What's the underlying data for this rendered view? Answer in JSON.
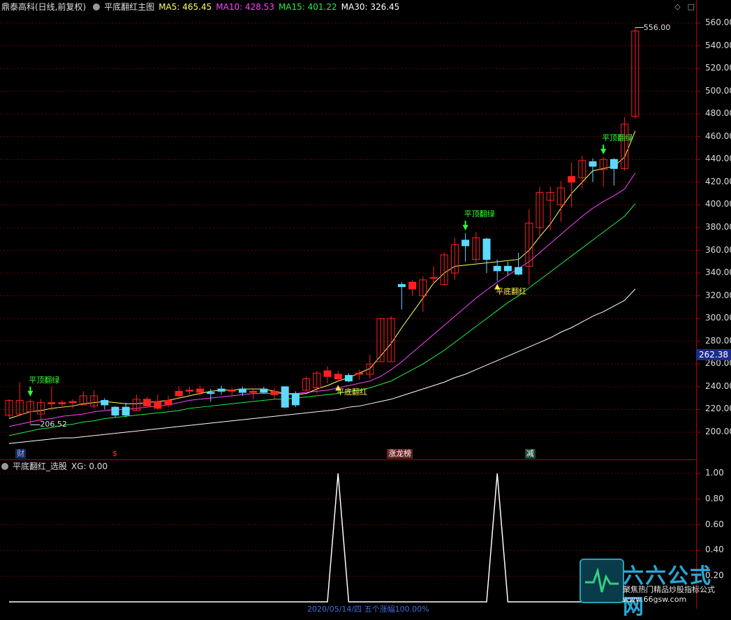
{
  "colors": {
    "background": "#000000",
    "grid": "#6a0000",
    "axis": "#b00000",
    "up": "#ff2020",
    "down": "#5fd8ff",
    "ma5": "#ffff66",
    "ma10": "#ff44ff",
    "ma15": "#22ee44",
    "ma30": "#ffffff",
    "signal_green": "#33ff33",
    "signal_red": "#ffee44"
  },
  "header": {
    "stock_name": "鼎泰高科(日线,前复权)",
    "indicator_name": "平底翻红主图",
    "ma5": "MA5: 465.45",
    "ma10": "MA10: 428.53",
    "ma15": "MA15: 401.22",
    "ma30": "MA30: 326.45"
  },
  "main_chart": {
    "y_ticks": [
      "560.00",
      "540.00",
      "520.00",
      "500.00",
      "480.00",
      "460.00",
      "440.00",
      "420.00",
      "400.00",
      "380.00",
      "360.00",
      "340.00",
      "320.00",
      "300.00",
      "280.00",
      "260.00",
      "240.00",
      "220.00",
      "200.00"
    ],
    "current_price_tag": "262.38",
    "high_label": "556.00",
    "low_label": "206.52",
    "signals": [
      {
        "text": "平顶翻绿",
        "kind": "green"
      },
      {
        "text": "平顶翻绿",
        "kind": "green"
      },
      {
        "text": "平顶翻绿",
        "kind": "green"
      },
      {
        "text": "平底翻红",
        "kind": "red"
      },
      {
        "text": "平底翻红",
        "kind": "red"
      }
    ],
    "events": [
      {
        "text": "财",
        "color": "#6aa0ff"
      },
      {
        "text": "$",
        "color": "#ff3030"
      },
      {
        "text": "涨龙榜",
        "color": "#ffffff"
      },
      {
        "text": "减",
        "color": "#ffffff"
      }
    ]
  },
  "sub_chart": {
    "title": "平底翻红_选股",
    "xg_label": "XG: 0.00",
    "y_ticks": [
      "1.00",
      "0.80",
      "0.60",
      "0.40",
      "0.20"
    ]
  },
  "footer": {
    "date_text": "2020/05/14/四  五个涨幅100.00%"
  },
  "watermark": {
    "brand": "六六公式网",
    "slogan": "聚焦热门精品炒股指标公式",
    "url": "www.66gsw.com"
  },
  "chart_data": {
    "type": "candlestick",
    "ylim": [
      190,
      570
    ],
    "candles": [
      {
        "o": 215,
        "c": 228,
        "h": 229,
        "l": 213
      },
      {
        "o": 216,
        "c": 228,
        "h": 244,
        "l": 214
      },
      {
        "o": 218,
        "c": 227,
        "h": 229,
        "l": 207
      },
      {
        "o": 216,
        "c": 226,
        "h": 229,
        "l": 210
      },
      {
        "o": 225,
        "c": 226,
        "h": 240,
        "l": 219
      },
      {
        "o": 225,
        "c": 226,
        "h": 228,
        "l": 222
      },
      {
        "o": 226,
        "c": 227,
        "h": 229,
        "l": 221
      },
      {
        "o": 224,
        "c": 232,
        "h": 236,
        "l": 224
      },
      {
        "o": 223,
        "c": 232,
        "h": 237,
        "l": 221
      },
      {
        "o": 228,
        "c": 224,
        "h": 230,
        "l": 220
      },
      {
        "o": 222,
        "c": 215,
        "h": 223,
        "l": 213
      },
      {
        "o": 222,
        "c": 215,
        "h": 226,
        "l": 213
      },
      {
        "o": 219,
        "c": 229,
        "h": 233,
        "l": 219
      },
      {
        "o": 223,
        "c": 229,
        "h": 231,
        "l": 223
      },
      {
        "o": 221,
        "c": 227,
        "h": 233,
        "l": 220
      },
      {
        "o": 224,
        "c": 228,
        "h": 232,
        "l": 222
      },
      {
        "o": 232,
        "c": 236,
        "h": 240,
        "l": 230
      },
      {
        "o": 236,
        "c": 237,
        "h": 240,
        "l": 233
      },
      {
        "o": 235,
        "c": 238,
        "h": 241,
        "l": 232
      },
      {
        "o": 235,
        "c": 234,
        "h": 238,
        "l": 227
      },
      {
        "o": 238,
        "c": 236,
        "h": 241,
        "l": 233
      },
      {
        "o": 236,
        "c": 237,
        "h": 239,
        "l": 231
      },
      {
        "o": 238,
        "c": 235,
        "h": 240,
        "l": 232
      },
      {
        "o": 235,
        "c": 236,
        "h": 238,
        "l": 229
      },
      {
        "o": 238,
        "c": 235,
        "h": 240,
        "l": 234
      },
      {
        "o": 233,
        "c": 236,
        "h": 239,
        "l": 229
      },
      {
        "o": 240,
        "c": 222,
        "h": 240,
        "l": 221
      },
      {
        "o": 234,
        "c": 224,
        "h": 236,
        "l": 222
      },
      {
        "o": 237,
        "c": 247,
        "h": 249,
        "l": 236
      },
      {
        "o": 239,
        "c": 252,
        "h": 254,
        "l": 234
      },
      {
        "o": 249,
        "c": 254,
        "h": 258,
        "l": 243
      },
      {
        "o": 247,
        "c": 251,
        "h": 254,
        "l": 244
      },
      {
        "o": 250,
        "c": 245,
        "h": 252,
        "l": 244
      },
      {
        "o": 251,
        "c": 252,
        "h": 255,
        "l": 246
      },
      {
        "o": 251,
        "c": 260,
        "h": 268,
        "l": 247
      },
      {
        "o": 262,
        "c": 300,
        "h": 300,
        "l": 262
      },
      {
        "o": 262,
        "c": 300,
        "h": 302,
        "l": 262
      },
      {
        "o": 330,
        "c": 328,
        "h": 332,
        "l": 308
      },
      {
        "o": 326,
        "c": 332,
        "h": 334,
        "l": 320
      },
      {
        "o": 320,
        "c": 334,
        "h": 337,
        "l": 306
      },
      {
        "o": 336,
        "c": 336,
        "h": 346,
        "l": 330
      },
      {
        "o": 330,
        "c": 356,
        "h": 358,
        "l": 329
      },
      {
        "o": 340,
        "c": 365,
        "h": 371,
        "l": 334
      },
      {
        "o": 369,
        "c": 364,
        "h": 375,
        "l": 350
      },
      {
        "o": 352,
        "c": 371,
        "h": 376,
        "l": 349
      },
      {
        "o": 370,
        "c": 352,
        "h": 371,
        "l": 340
      },
      {
        "o": 346,
        "c": 342,
        "h": 352,
        "l": 333
      },
      {
        "o": 346,
        "c": 342,
        "h": 350,
        "l": 338
      },
      {
        "o": 345,
        "c": 339,
        "h": 358,
        "l": 338
      },
      {
        "o": 346,
        "c": 384,
        "h": 396,
        "l": 330
      },
      {
        "o": 380,
        "c": 411,
        "h": 416,
        "l": 372
      },
      {
        "o": 404,
        "c": 411,
        "h": 416,
        "l": 378
      },
      {
        "o": 400,
        "c": 415,
        "h": 421,
        "l": 385
      },
      {
        "o": 420,
        "c": 425,
        "h": 437,
        "l": 398
      },
      {
        "o": 424,
        "c": 439,
        "h": 443,
        "l": 415
      },
      {
        "o": 438,
        "c": 434,
        "h": 441,
        "l": 420
      },
      {
        "o": 431,
        "c": 440,
        "h": 442,
        "l": 416
      },
      {
        "o": 440,
        "c": 432,
        "h": 441,
        "l": 417
      },
      {
        "o": 432,
        "c": 471,
        "h": 477,
        "l": 430
      },
      {
        "o": 478,
        "c": 553,
        "h": 556,
        "l": 476
      }
    ],
    "ma5": [
      212,
      215,
      218,
      219,
      221,
      222,
      223,
      225,
      226,
      227,
      226,
      225,
      225,
      226,
      227,
      228,
      230,
      232,
      234,
      236,
      237,
      237,
      238,
      238,
      238,
      236,
      234,
      233,
      234,
      238,
      241,
      245,
      248,
      252,
      256,
      267,
      278,
      292,
      305,
      318,
      331,
      340,
      346,
      347,
      348,
      349,
      350,
      351,
      352,
      360,
      372,
      383,
      397,
      410,
      420,
      430,
      432,
      434,
      442,
      465
    ],
    "ma10": [
      205,
      207,
      209,
      211,
      212,
      214,
      215,
      216,
      218,
      219,
      220,
      220,
      221,
      222,
      223,
      224,
      226,
      228,
      229,
      230,
      231,
      232,
      233,
      234,
      234,
      234,
      234,
      234,
      235,
      236,
      237,
      239,
      241,
      243,
      245,
      249,
      255,
      262,
      270,
      278,
      286,
      294,
      302,
      310,
      318,
      325,
      332,
      338,
      344,
      350,
      358,
      366,
      374,
      382,
      390,
      397,
      403,
      408,
      414,
      428
    ],
    "ma15": [
      197,
      199,
      201,
      203,
      204,
      206,
      207,
      209,
      210,
      212,
      213,
      214,
      215,
      216,
      217,
      218,
      219,
      221,
      222,
      223,
      224,
      225,
      226,
      227,
      228,
      229,
      229,
      230,
      231,
      232,
      233,
      234,
      236,
      237,
      239,
      242,
      245,
      250,
      255,
      260,
      266,
      272,
      279,
      286,
      293,
      300,
      307,
      314,
      320,
      327,
      334,
      341,
      348,
      355,
      362,
      369,
      376,
      383,
      390,
      401
    ],
    "ma30": [
      190,
      191,
      192,
      193,
      194,
      195,
      195,
      196,
      197,
      198,
      199,
      200,
      201,
      202,
      203,
      204,
      205,
      206,
      207,
      208,
      209,
      210,
      211,
      212,
      213,
      214,
      215,
      216,
      217,
      218,
      219,
      220,
      222,
      223,
      225,
      227,
      229,
      232,
      235,
      238,
      241,
      244,
      248,
      251,
      255,
      259,
      263,
      267,
      271,
      275,
      279,
      283,
      288,
      292,
      297,
      302,
      306,
      311,
      316,
      326
    ],
    "signals": [
      {
        "index": 2,
        "type": "平顶翻绿",
        "arrow": "down"
      },
      {
        "index": 31,
        "type": "平底翻红",
        "arrow": "up"
      },
      {
        "index": 43,
        "type": "平顶翻绿",
        "arrow": "down"
      },
      {
        "index": 46,
        "type": "平底翻红",
        "arrow": "up"
      },
      {
        "index": 56,
        "type": "平顶翻绿",
        "arrow": "down"
      }
    ],
    "events": [
      {
        "index": 1,
        "text": "财"
      },
      {
        "index": 10,
        "text": "$"
      },
      {
        "index": 36,
        "text": "涨龙榜"
      },
      {
        "index": 49,
        "text": "减"
      }
    ],
    "xg": {
      "ylim": [
        0,
        1.1
      ],
      "values": [
        0,
        0,
        0,
        0,
        0,
        0,
        0,
        0,
        0,
        0,
        0,
        0,
        0,
        0,
        0,
        0,
        0,
        0,
        0,
        0,
        0,
        0,
        0,
        0,
        0,
        0,
        0,
        0,
        0,
        0,
        0,
        1,
        0,
        0,
        0,
        0,
        0,
        0,
        0,
        0,
        0,
        0,
        0,
        0,
        0,
        0,
        1,
        0,
        0,
        0,
        0,
        0,
        0,
        0,
        0,
        0,
        0,
        0,
        0,
        0
      ]
    }
  }
}
